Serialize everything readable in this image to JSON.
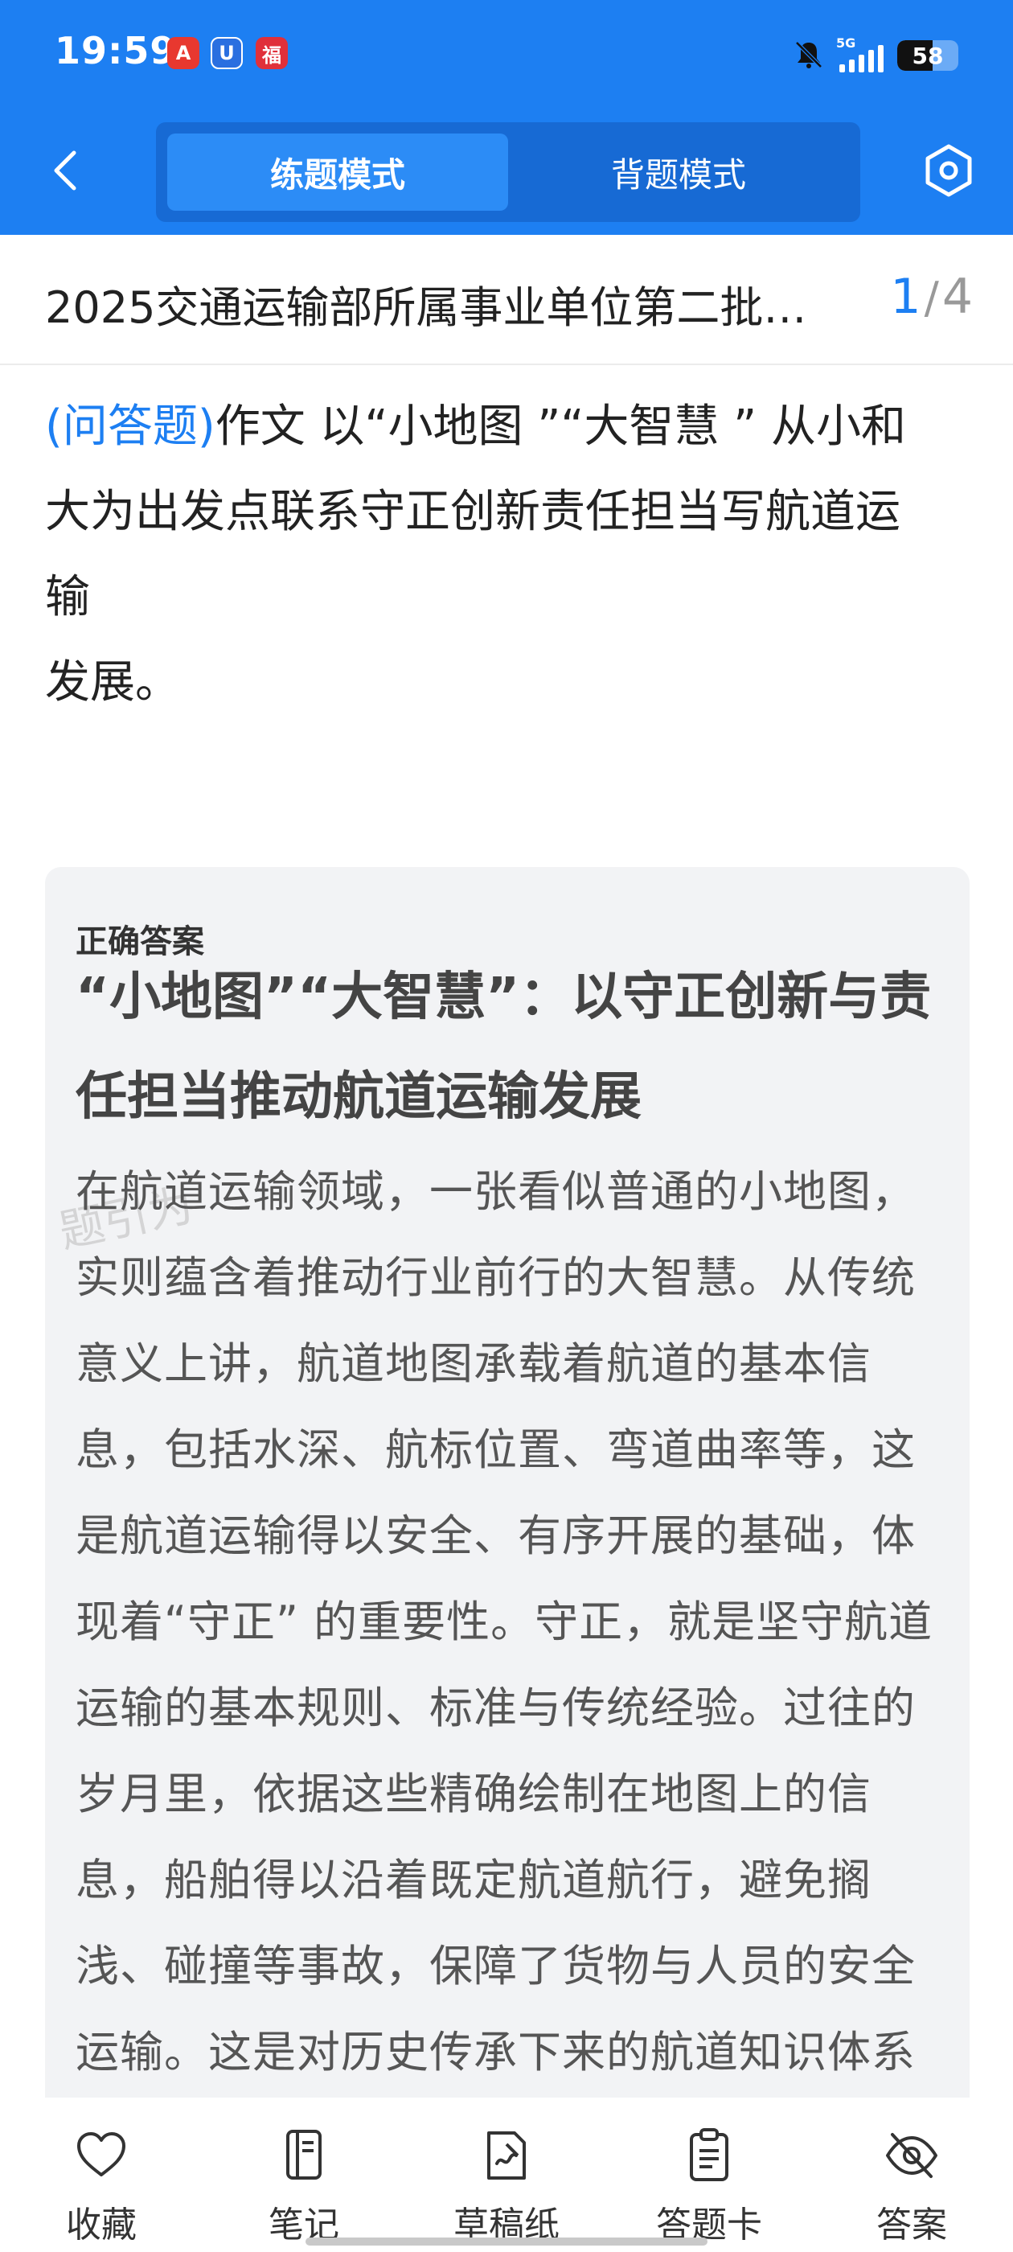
{
  "status_bar": {
    "time": "19:59",
    "network": "5G",
    "battery": "58",
    "battery_level": 0.58,
    "app_icons": [
      "A",
      "U",
      "福"
    ]
  },
  "nav": {
    "tabs": [
      {
        "label": "练题模式",
        "active": true
      },
      {
        "label": "背题模式",
        "active": false
      }
    ]
  },
  "paper": {
    "title": "2025交通运输部所属事业单位第二批…",
    "current": "1",
    "total": "4"
  },
  "question": {
    "type": "(问答题)",
    "line1": "作文 以“小地图 ”“大智慧 ” 从小和",
    "line2": "大为出发点联系守正创新责任担当写航道运",
    "line3": "输",
    "line4": "发展。"
  },
  "answer": {
    "label": "正确答案",
    "heading": "“小地图”“大智慧”：以守正创新与责任担当推动航道运输发展",
    "body": "在航道运输领域，一张看似普通的小地图，实则蕴含着推动行业前行的大智慧。从传统意义上讲，航道地图承载着航道的基本信息，包括水深、航标位置、弯道曲率等，这是航道运输得以安全、有序开展的基础，体现着“守正” 的重要性。守正，就是坚守航道运输的基本规则、标准与传统经验。过往的岁月里，依据这些精确绘制在地图上的信息，船舶得以沿着既定航道航行，避免搁浅、碰撞等事故，保障了货物与人员的安全运输。这是对历史传承下来的航道知识体系",
    "watermark": "题引为"
  },
  "toolbar": [
    {
      "label": "收藏",
      "icon": "heart-icon"
    },
    {
      "label": "笔记",
      "icon": "notebook-icon"
    },
    {
      "label": "草稿纸",
      "icon": "draft-icon"
    },
    {
      "label": "答题卡",
      "icon": "clipboard-icon"
    },
    {
      "label": "答案",
      "icon": "eye-off-icon"
    }
  ],
  "colors": {
    "brand": "#1d7ff2",
    "card_bg": "#f2f3f5"
  }
}
